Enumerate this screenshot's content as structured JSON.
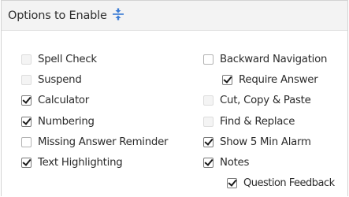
{
  "panel": {
    "title": "Options to Enable",
    "collapse_icon": "collapse-vertical-icon"
  },
  "options": [
    {
      "id": "spell-check",
      "label": "Spell Check",
      "checked": false,
      "disabled": true
    },
    {
      "id": "suspend",
      "label": "Suspend",
      "checked": false,
      "disabled": true
    },
    {
      "id": "calculator",
      "label": "Calculator",
      "checked": true,
      "disabled": false
    },
    {
      "id": "numbering",
      "label": "Numbering",
      "checked": true,
      "disabled": false
    },
    {
      "id": "missing-answer-reminder",
      "label": "Missing Answer Reminder",
      "checked": false,
      "disabled": false
    },
    {
      "id": "text-highlighting",
      "label": "Text Highlighting",
      "checked": true,
      "disabled": false
    },
    {
      "id": "backward-navigation",
      "label": "Backward Navigation",
      "checked": false,
      "disabled": false
    },
    {
      "id": "require-answer",
      "label": "Require Answer",
      "checked": true,
      "disabled": false
    },
    {
      "id": "cut-copy-paste",
      "label": "Cut, Copy & Paste",
      "checked": false,
      "disabled": true
    },
    {
      "id": "find-replace",
      "label": "Find & Replace",
      "checked": false,
      "disabled": true
    },
    {
      "id": "show-5-min-alarm",
      "label": "Show 5 Min Alarm",
      "checked": true,
      "disabled": false
    },
    {
      "id": "notes",
      "label": "Notes",
      "checked": true,
      "disabled": false
    },
    {
      "id": "question-feedback",
      "label": "Question Feedback",
      "checked": true,
      "disabled": false
    }
  ]
}
